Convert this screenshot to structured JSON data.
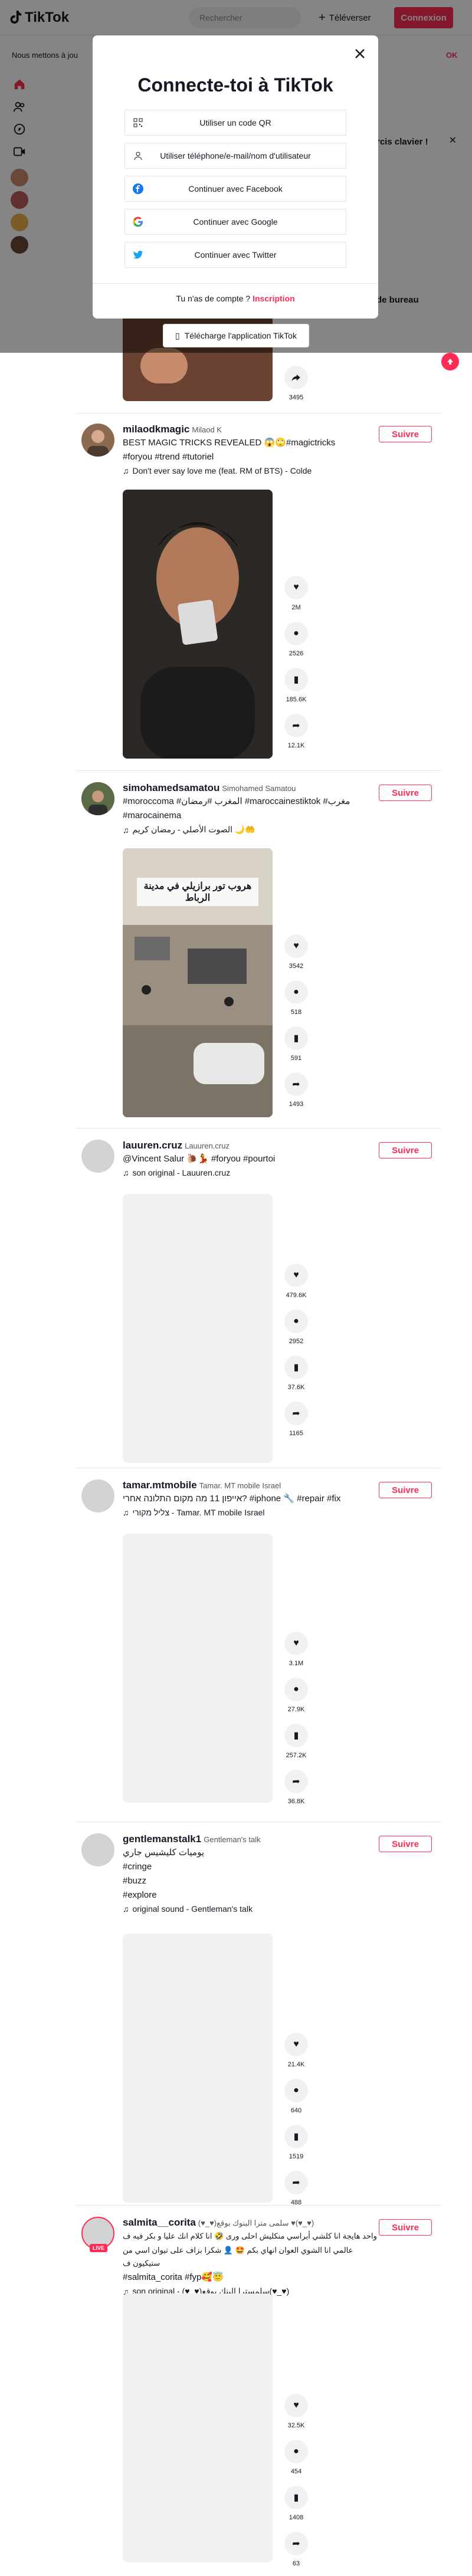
{
  "header": {
    "logo": "TikTok",
    "search_placeholder": "Rechercher",
    "upload_label": "Téléverser",
    "login_label": "Connexion"
  },
  "cookie_bar": {
    "text": "Nous mettons à jou",
    "ok_label": "OK"
  },
  "side_panel": {
    "shortcuts_title": "rcis clavier !",
    "desktop_title": "de bureau"
  },
  "modal": {
    "title": "Connecte-toi à TikTok",
    "options": [
      {
        "label": "Utiliser un code QR",
        "icon": "qr-icon"
      },
      {
        "label": "Utiliser téléphone/e-mail/nom d'utilisateur",
        "icon": "user-icon"
      },
      {
        "label": "Continuer avec Facebook",
        "icon": "facebook-icon"
      },
      {
        "label": "Continuer avec Google",
        "icon": "google-icon"
      },
      {
        "label": "Continuer avec Twitter",
        "icon": "twitter-icon"
      }
    ],
    "no_account": "Tu n'as de compte ?",
    "signup_link": "Inscription",
    "download_label": "Télécharge l'application TikTok"
  },
  "top_post_actions": {
    "share_count": "3495"
  },
  "posts": [
    {
      "username": "milaodkmagic",
      "nickname": "Milaod K",
      "desc_lines": [
        "BEST MAGIC TRICKS REVEALED 😱🙄#magictricks",
        "#foryou #trend #tutoriel"
      ],
      "music": "Don't ever say love me (feat. RM of BTS) - Colde",
      "follow_label": "Suivre",
      "likes": "2M",
      "comments": "2526",
      "saves": "185.6K",
      "shares": "12.1K"
    },
    {
      "username": "simohamedsamatou",
      "nickname": "Simohamed Samatou",
      "desc_lines": [
        "#moroccoma #المغرب #رمضان #maroccainestiktok #مغرب",
        "#marocainema"
      ],
      "music": "الصوت الأصلي - رمضان كريم 🌙🤲",
      "follow_label": "Suivre",
      "likes": "3542",
      "comments": "518",
      "saves": "591",
      "shares": "1493",
      "video_overlay": "هروب تور برازيلي في مدينة الرباط"
    },
    {
      "username": "lauuren.cruz",
      "nickname": "Lauuren.cruz",
      "desc_lines": [
        "@Vincent Salur 🐌💃 #foryou #pourtoi"
      ],
      "music": "son original - Lauuren.cruz",
      "follow_label": "Suivre",
      "likes": "479.6K",
      "comments": "2952",
      "saves": "37.6K",
      "shares": "1165"
    },
    {
      "username": "tamar.mtmobile",
      "nickname": "Tamar. MT mobile Israel",
      "desc_lines": [
        "אייפון 11 מה מקום התלונה אחרי? #iphone 🔧 #repair #fix"
      ],
      "music": "צליל מקורי - Tamar. MT mobile Israel",
      "follow_label": "Suivre",
      "likes": "3.1M",
      "comments": "27.9K",
      "saves": "257.2K",
      "shares": "36.8K"
    },
    {
      "username": "gentlemanstalk1",
      "nickname": "Gentleman's talk",
      "desc_lines": [
        "يوميات كليشيس جاري",
        "#cringe",
        "#buzz",
        "#explore"
      ],
      "music": "original sound - Gentleman's talk",
      "follow_label": "Suivre",
      "likes": "21.4K",
      "comments": "640",
      "saves": "1519",
      "shares": "488"
    },
    {
      "username": "salmita__corita",
      "nickname": "(♥_♥)سلمى مترا البنوك بوقع ♥(♥_♥)",
      "desc_lines": [
        "واحد هايجة انا كلشي أبراسي منكليش احلى ورى 🤣 انا كلام انك عليا و بكر فيه ف",
        "عالمي انا الشوي العوان انهاي بكم 🤩 👤 شكرا بزاف على تيوان اسي من ستيكيون ف",
        "#salmita_corita #fyp🥰😇"
      ],
      "music": "son original - (♥_♥)سلمسترا البنك بوقع(♥_♥)",
      "follow_label": "Suivre",
      "likes": "32.5K",
      "comments": "454",
      "saves": "1408",
      "shares": "63",
      "live_badge": "LIVE"
    }
  ]
}
